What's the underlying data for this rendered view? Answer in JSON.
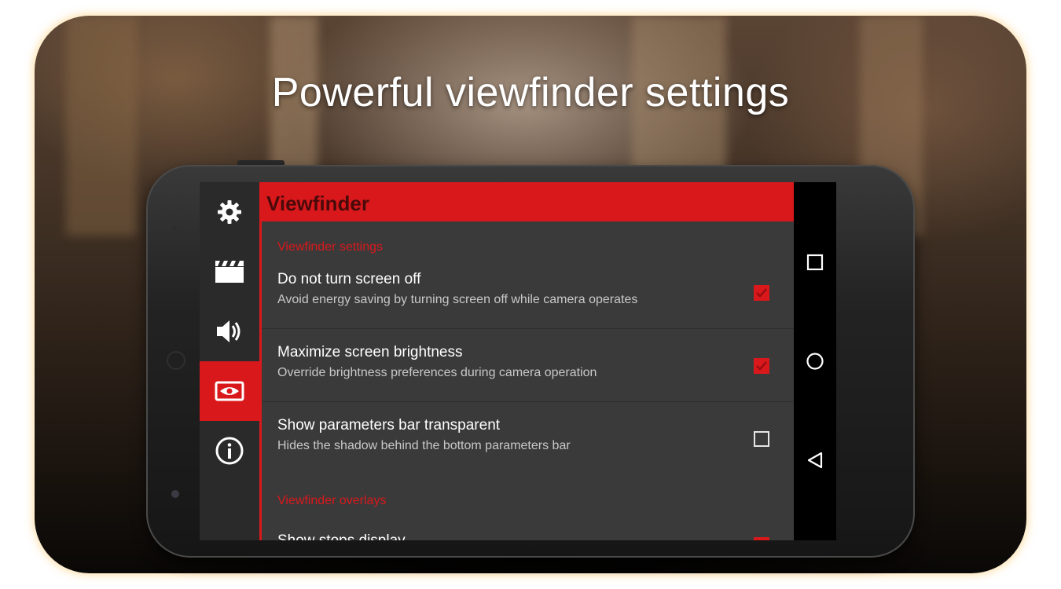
{
  "banner": {
    "headline": "Powerful viewfinder settings"
  },
  "screen": {
    "header_title": "Viewfinder",
    "sections": [
      {
        "label": "Viewfinder settings"
      },
      {
        "label": "Viewfinder overlays"
      }
    ],
    "rows": [
      {
        "title": "Do not turn screen off",
        "subtitle": "Avoid energy saving by turning screen off while camera operates",
        "checked": true
      },
      {
        "title": "Maximize screen brightness",
        "subtitle": "Override brightness preferences during camera operation",
        "checked": true
      },
      {
        "title": "Show parameters bar transparent",
        "subtitle": "Hides the shadow behind the bottom parameters bar",
        "checked": false
      },
      {
        "title": "Show stops display",
        "subtitle": "",
        "checked": true
      }
    ],
    "rail_icons": [
      "gear-icon",
      "clapperboard-icon",
      "speaker-icon",
      "eye-icon",
      "info-icon"
    ],
    "active_rail_item": "eye-icon"
  },
  "navbar": {
    "icons": [
      "square-icon",
      "circle-icon",
      "back-triangle-icon"
    ]
  },
  "colors": {
    "accent": "#d9181c",
    "list_bg": "#3a3a3a",
    "rail_bg": "#2a2a2a"
  }
}
